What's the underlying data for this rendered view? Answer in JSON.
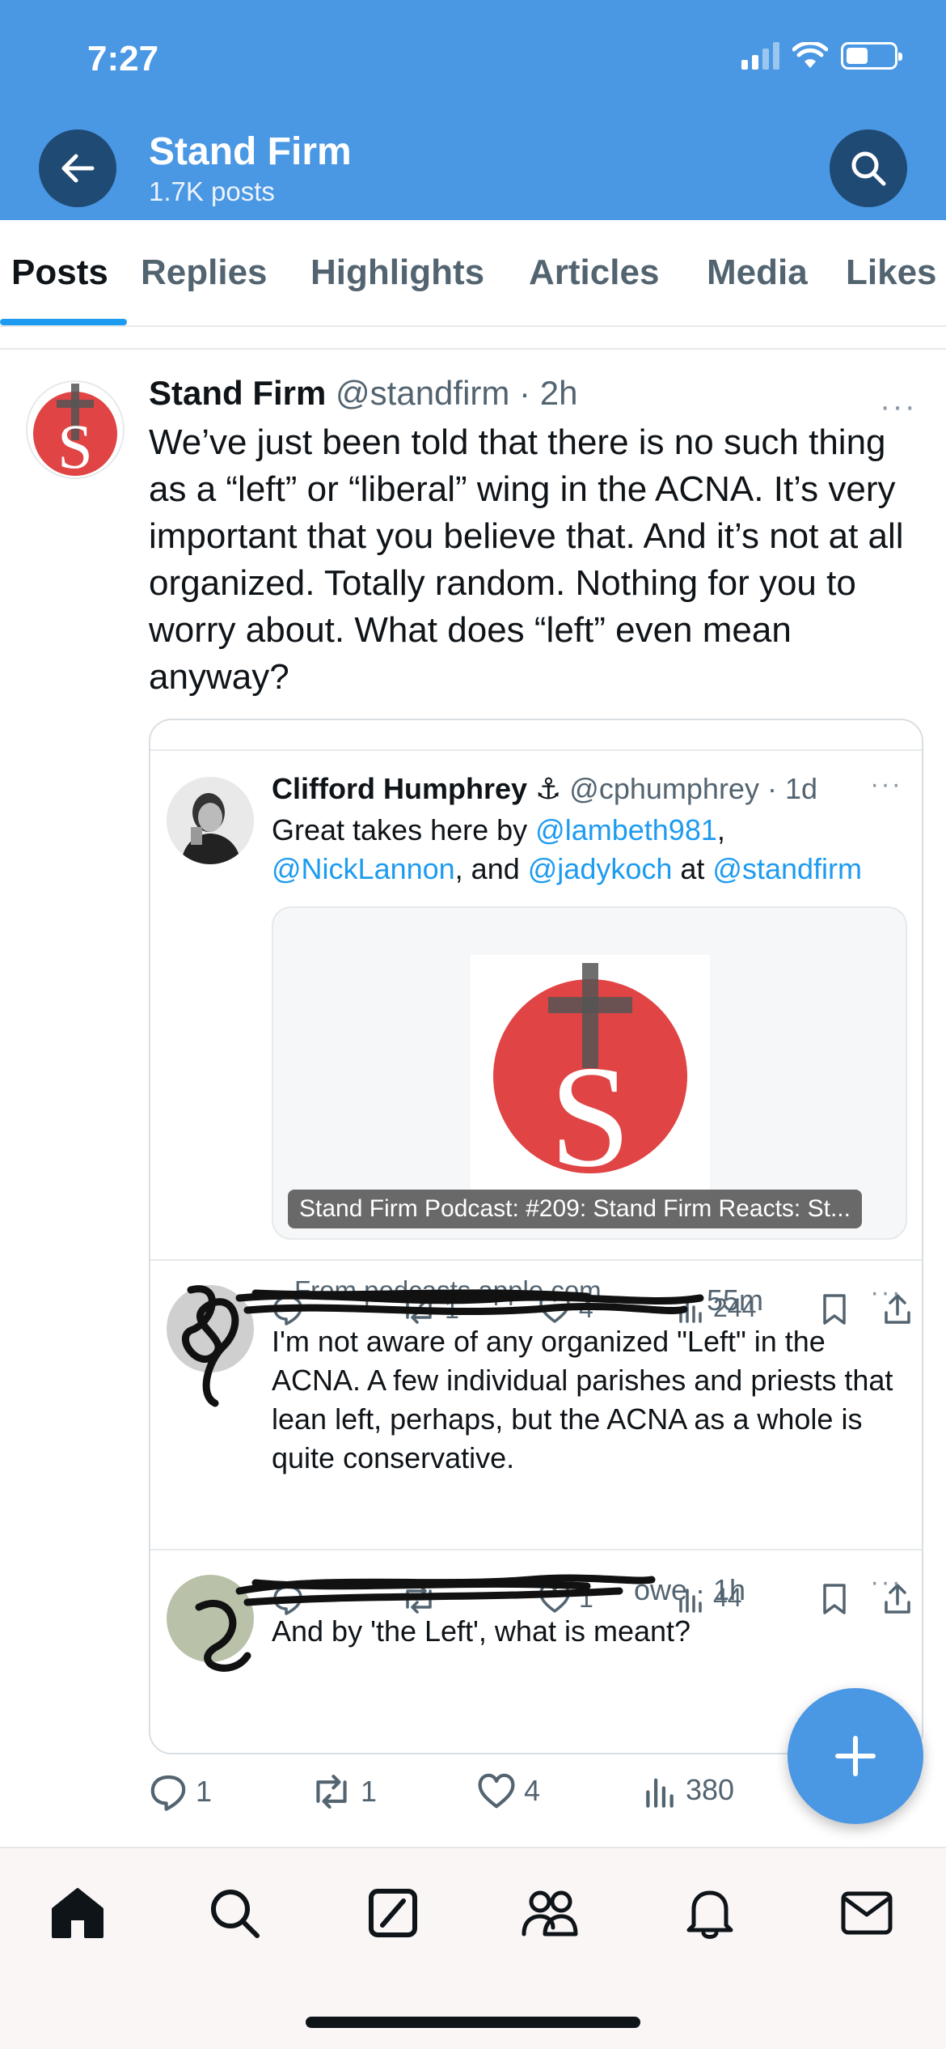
{
  "status_bar": {
    "time": "7:27"
  },
  "header": {
    "title": "Stand Firm",
    "subtitle": "1.7K posts"
  },
  "tabs": [
    {
      "label": "Posts",
      "active": true
    },
    {
      "label": "Replies",
      "active": false
    },
    {
      "label": "Highlights",
      "active": false
    },
    {
      "label": "Articles",
      "active": false
    },
    {
      "label": "Media",
      "active": false
    },
    {
      "label": "Likes",
      "active": false
    }
  ],
  "post": {
    "author_name": "Stand Firm",
    "handle_time": "@standfirm · 2h",
    "text": "We’ve just been told that there is no such thing as a “left” or “liberal” wing in the ACNA. It’s very important that you believe that. And it’s not at all organized. Totally random. Nothing for you to worry about. What does “left” even mean anyway?",
    "more": "···",
    "avatar_letter": "S",
    "stats": {
      "replies": "1",
      "reposts": "1",
      "likes": "4",
      "views": "380"
    }
  },
  "quote": {
    "reply1": {
      "author_name": "Clifford Humphrey ⚓",
      "handle_time": "@cphumphrey · 1d",
      "text_parts": {
        "a": "Great takes here by ",
        "m1": "@lambeth981",
        "b": ", ",
        "m2": "@NickLannon",
        "c": ", and ",
        "m3": "@jadykoch",
        "d": " at ",
        "m4": "@standfirm"
      },
      "card_caption": "Stand Firm Podcast: #209: Stand Firm Reacts: St...",
      "from": "From podcasts.apple.com",
      "stats": {
        "reposts": "1",
        "likes": "4",
        "views": "244"
      }
    },
    "reply2": {
      "time": "55m",
      "text": "I'm not aware of any organized \"Left\" in the ACNA. A few individual parishes and priests that lean left, perhaps, but the ACNA as a whole is quite conservative.",
      "stats": {
        "likes": "1",
        "views": "44"
      }
    },
    "reply3": {
      "time": "owe · 1h",
      "text": "And by 'the Left', what is meant?"
    }
  },
  "colors": {
    "header_bg": "#4a97e4",
    "accent": "#1d9bf0",
    "logo_red": "#e04444"
  },
  "icons": [
    "back-arrow-icon",
    "search-icon",
    "reply-icon",
    "repost-icon",
    "like-icon",
    "views-icon",
    "bookmark-icon",
    "share-icon",
    "plus-icon",
    "home-icon",
    "explore-icon",
    "grok-icon",
    "communities-icon",
    "notifications-icon",
    "messages-icon"
  ]
}
